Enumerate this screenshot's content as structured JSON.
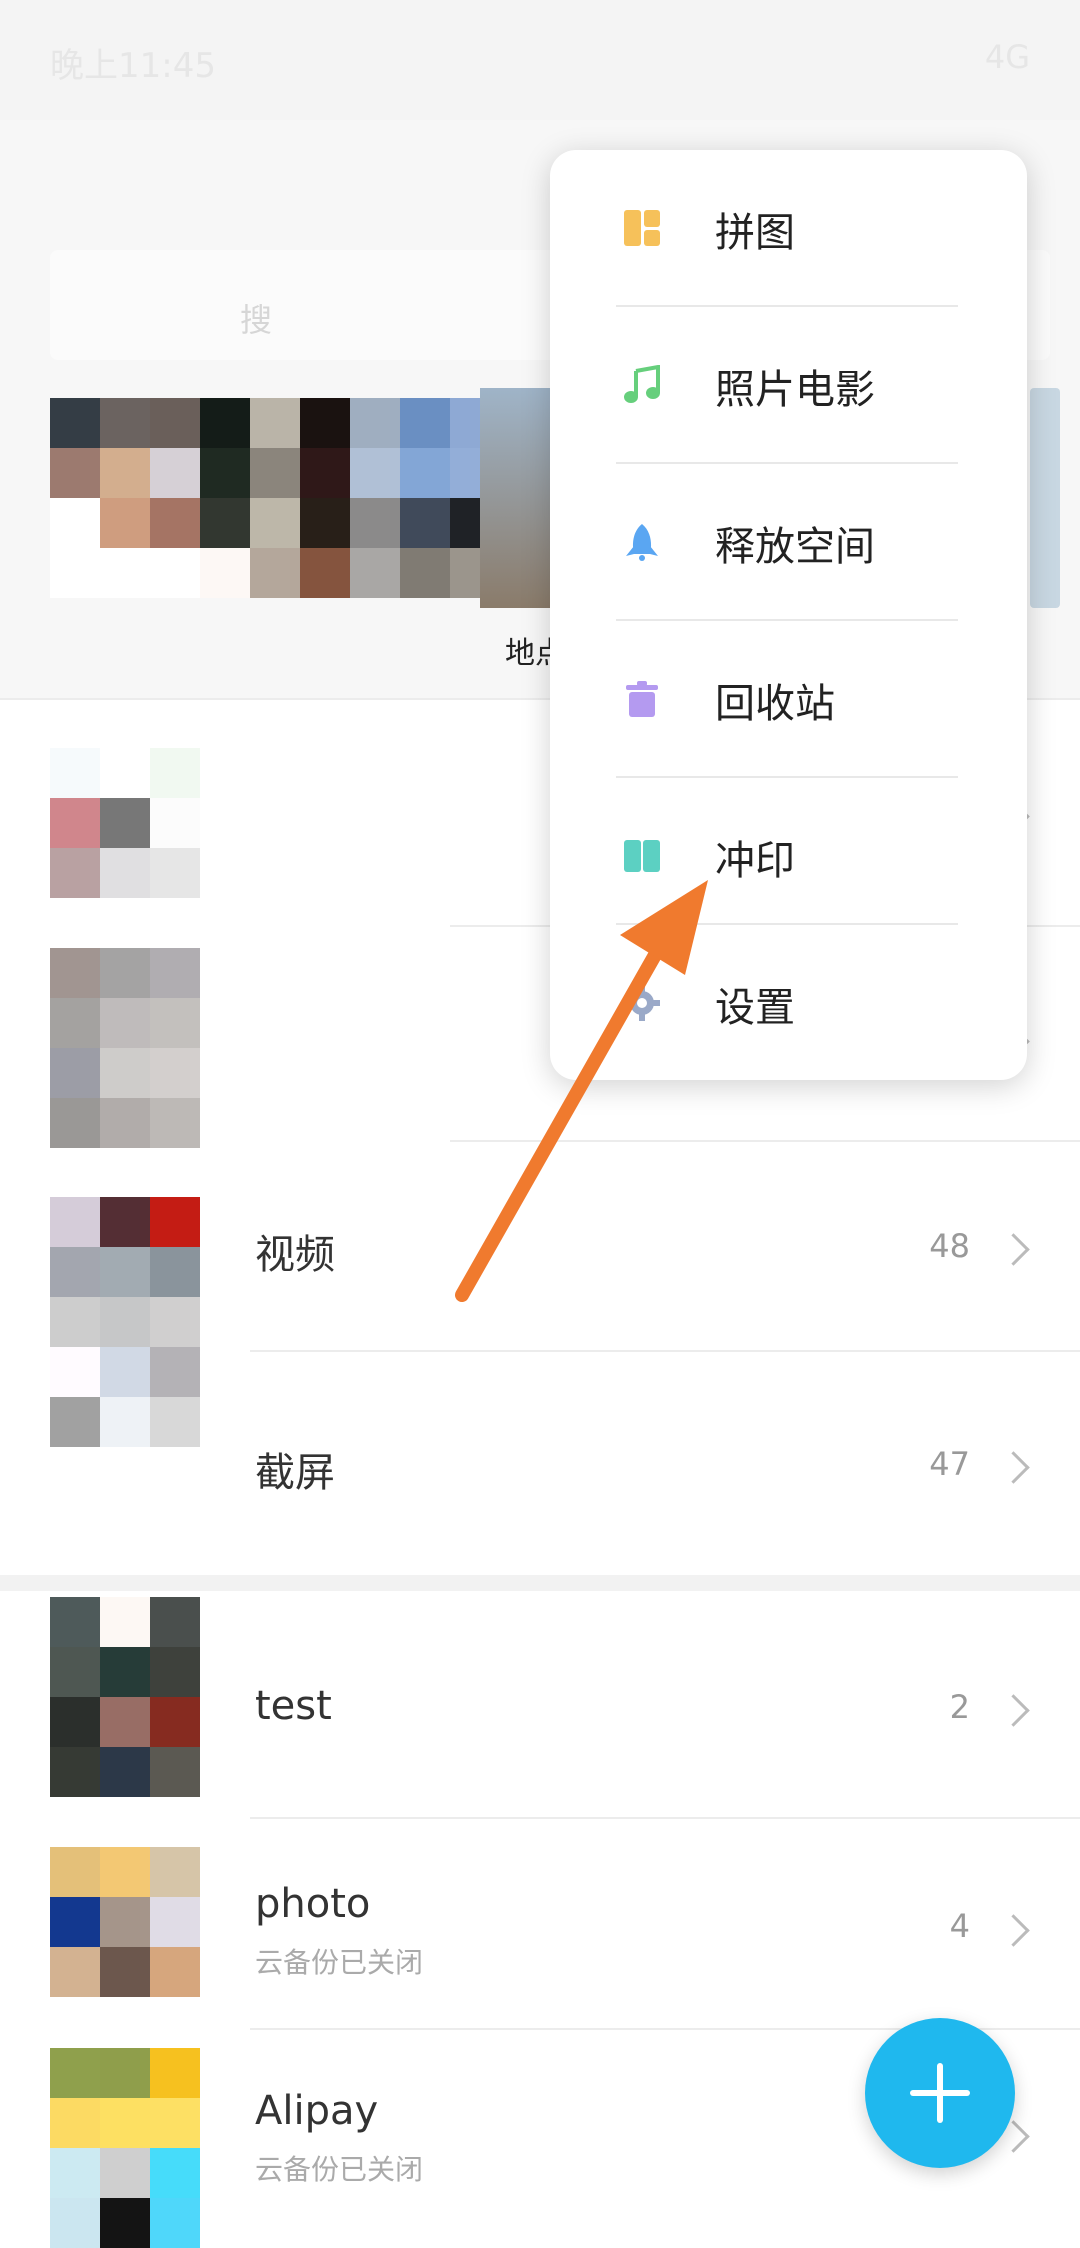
{
  "status_bar": {
    "time": "晚上11:45",
    "network": "4G"
  },
  "search": {
    "placeholder": "搜"
  },
  "nearby_card": {
    "label": "地点"
  },
  "menu": {
    "items": [
      {
        "label": "拼图",
        "icon": "collage-icon",
        "color": "#f6c15a"
      },
      {
        "label": "照片电影",
        "icon": "music-note-icon",
        "color": "#66cf7c"
      },
      {
        "label": "释放空间",
        "icon": "rocket-icon",
        "color": "#5aa6f2"
      },
      {
        "label": "回收站",
        "icon": "trash-icon",
        "color": "#b49af0"
      },
      {
        "label": "冲印",
        "icon": "print-icon",
        "color": "#5cd0c2"
      },
      {
        "label": "设置",
        "icon": "gear-icon",
        "color": "#9aa9c8"
      }
    ]
  },
  "albums": [
    {
      "name": "",
      "sub": "",
      "count": ""
    },
    {
      "name": "",
      "sub": "",
      "count": ""
    },
    {
      "name": "视频",
      "sub": "",
      "count": "48"
    },
    {
      "name": "截屏",
      "sub": "",
      "count": "47"
    },
    {
      "name": "test",
      "sub": "",
      "count": "2"
    },
    {
      "name": "photo",
      "sub": "云备份已关闭",
      "count": "4"
    },
    {
      "name": "Alipay",
      "sub": "云备份已关闭",
      "count": ""
    }
  ],
  "fab": {
    "label": "+"
  },
  "colors": {
    "accent": "#1fb8ee",
    "arrow": "#f07a2e"
  }
}
